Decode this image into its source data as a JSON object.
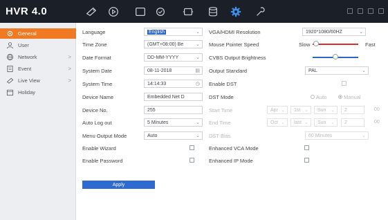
{
  "header": {
    "brand": "HVR 4.0",
    "icons": [
      "live-view-icon",
      "playback-icon",
      "file-icon",
      "search-icon",
      "camera-icon",
      "storage-icon",
      "settings-icon",
      "maintenance-icon"
    ],
    "active_icon": "settings-icon"
  },
  "sidebar": {
    "items": [
      {
        "label": "General",
        "icon": "gear-icon",
        "active": true,
        "chevron": ""
      },
      {
        "label": "User",
        "icon": "user-icon",
        "active": false,
        "chevron": ""
      },
      {
        "label": "Network",
        "icon": "globe-icon",
        "active": false,
        "chevron": ">"
      },
      {
        "label": "Event",
        "icon": "event-icon",
        "active": false,
        "chevron": ">"
      },
      {
        "label": "Live View",
        "icon": "camera-icon",
        "active": false,
        "chevron": ">"
      },
      {
        "label": "Holiday",
        "icon": "calendar-icon",
        "active": false,
        "chevron": ""
      }
    ]
  },
  "left_form": {
    "language_label": "Language",
    "language_value": "English",
    "timezone_label": "Time Zone",
    "timezone_value": "(GMT+08:00) Be",
    "dateformat_label": "Date Format",
    "dateformat_value": "DD-MM-YYYY",
    "systemdate_label": "System Date",
    "systemdate_value": "08-11-2018",
    "systemtime_label": "System Time",
    "systemtime_value": "14:14:33",
    "devicename_label": "Device Name",
    "devicename_value": "Embedded Net D",
    "deviceno_label": "Device No.",
    "deviceno_value": "255",
    "autologout_label": "Auto Log out",
    "autologout_value": "5 Minutes",
    "menuoutput_label": "Menu Output Mode",
    "menuoutput_value": "Auto",
    "wizard_label": "Enable Wizard",
    "password_label": "Enable Password",
    "apply_label": "Apply"
  },
  "right_form": {
    "resolution_label": "VGA/HDMI Resolution",
    "resolution_value": "1920*1080/60HZ",
    "pointer_label": "Mouse Pointer Speed",
    "pointer_slow": "Slow",
    "pointer_fast": "Fast",
    "pointer_level": 0.08,
    "cvbs_label": "CVBS Output Brightness",
    "cvbs_level": 0.5,
    "outputstd_label": "Output Standard",
    "outputstd_value": "PAL",
    "dst_label": "Enable DST",
    "dstmode_label": "DST Mode",
    "dstmode_auto": "Auto",
    "dstmode_manual": "Manual",
    "starttime_label": "Start Time",
    "start_month": "Apr",
    "start_week": "1st",
    "start_day": "Sun",
    "start_hour": "2",
    "start_min": "00",
    "endtime_label": "End Time",
    "end_month": "Oct",
    "end_week": "last",
    "end_day": "Sun",
    "end_hour": "2",
    "end_min": "00",
    "dstbias_label": "DST Bias",
    "dstbias_value": "60 Minutes",
    "vca_label": "Enhanced VCA Mode",
    "ip_label": "Enhanced IP Mode"
  },
  "colors": {
    "accent": "#f07a23",
    "primary": "#2e6bd0",
    "topbar": "#1b1f28"
  }
}
